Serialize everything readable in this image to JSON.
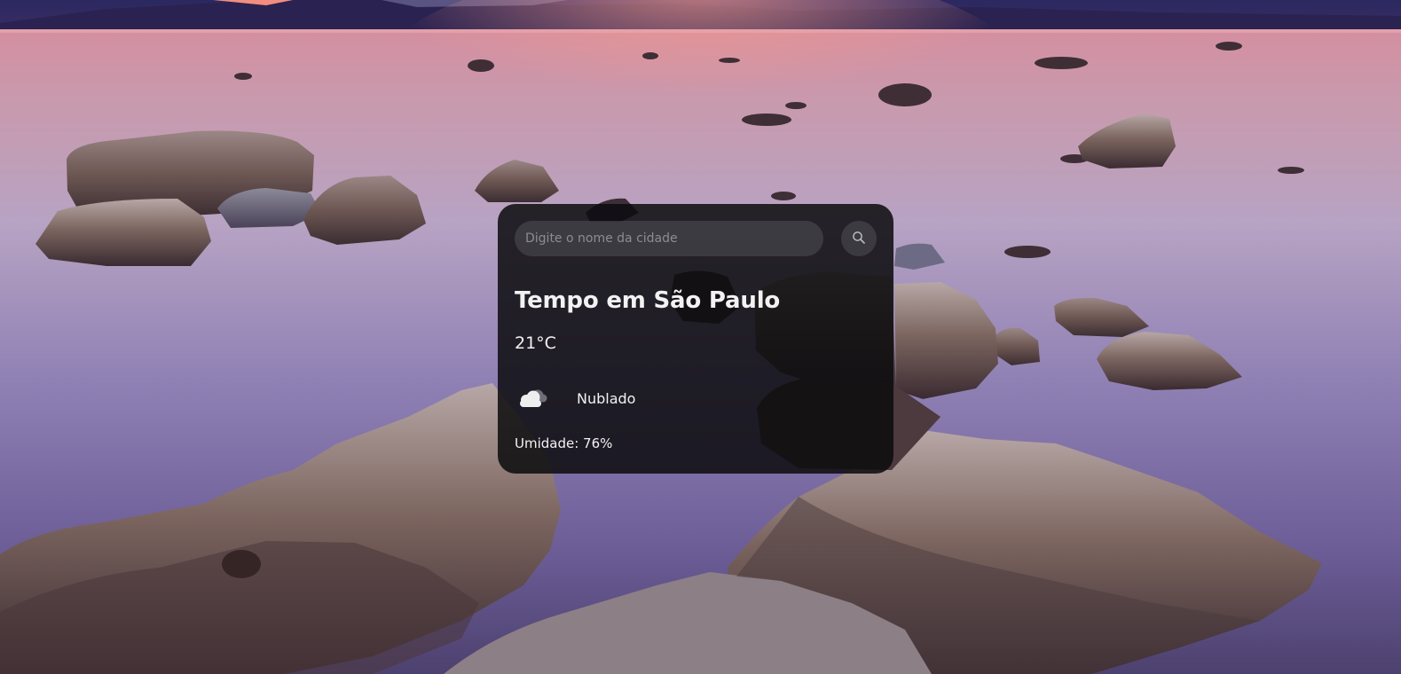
{
  "search": {
    "placeholder": "Digite o nome da cidade",
    "value": "",
    "button_icon": "search-icon"
  },
  "weather": {
    "title": "Tempo em São Paulo",
    "temperature": "21°C",
    "description": "Nublado",
    "icon": "cloudy-icon",
    "humidity": "Umidade: 76%"
  },
  "background": {
    "subject": "rocky-lake-sunset",
    "colors": {
      "sky": "#2a2558",
      "water_top": "#c98aa0",
      "water_mid": "#8b7bb0",
      "water_bottom": "#5c4d80",
      "rock": "#6a5552"
    }
  }
}
